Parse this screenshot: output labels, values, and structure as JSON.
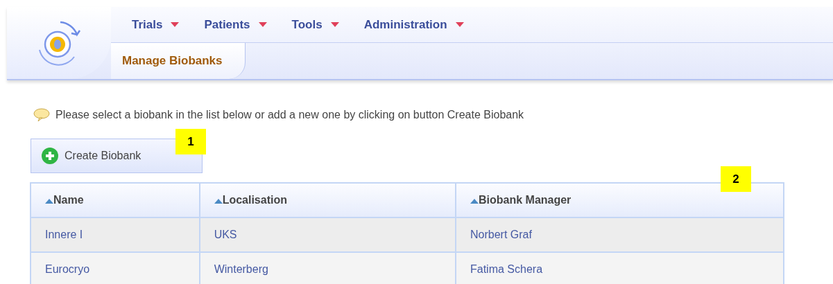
{
  "menu": [
    {
      "label": "Trials"
    },
    {
      "label": "Patients"
    },
    {
      "label": "Tools"
    },
    {
      "label": "Administration"
    }
  ],
  "sub_tabs": [
    {
      "label": "Manage Biobanks",
      "selected": true
    }
  ],
  "info": "Please select a biobank in the list below or add a new one by clicking on button Create Biobank",
  "create_button": "Create Biobank",
  "table": {
    "columns": [
      "Name",
      "Localisation",
      "Biobank Manager"
    ],
    "rows": [
      [
        "Innere I",
        "UKS",
        "Norbert Graf"
      ],
      [
        "Eurocryo",
        "Winterberg",
        "Fatima Schera"
      ]
    ]
  },
  "callouts": [
    "1",
    "2"
  ]
}
